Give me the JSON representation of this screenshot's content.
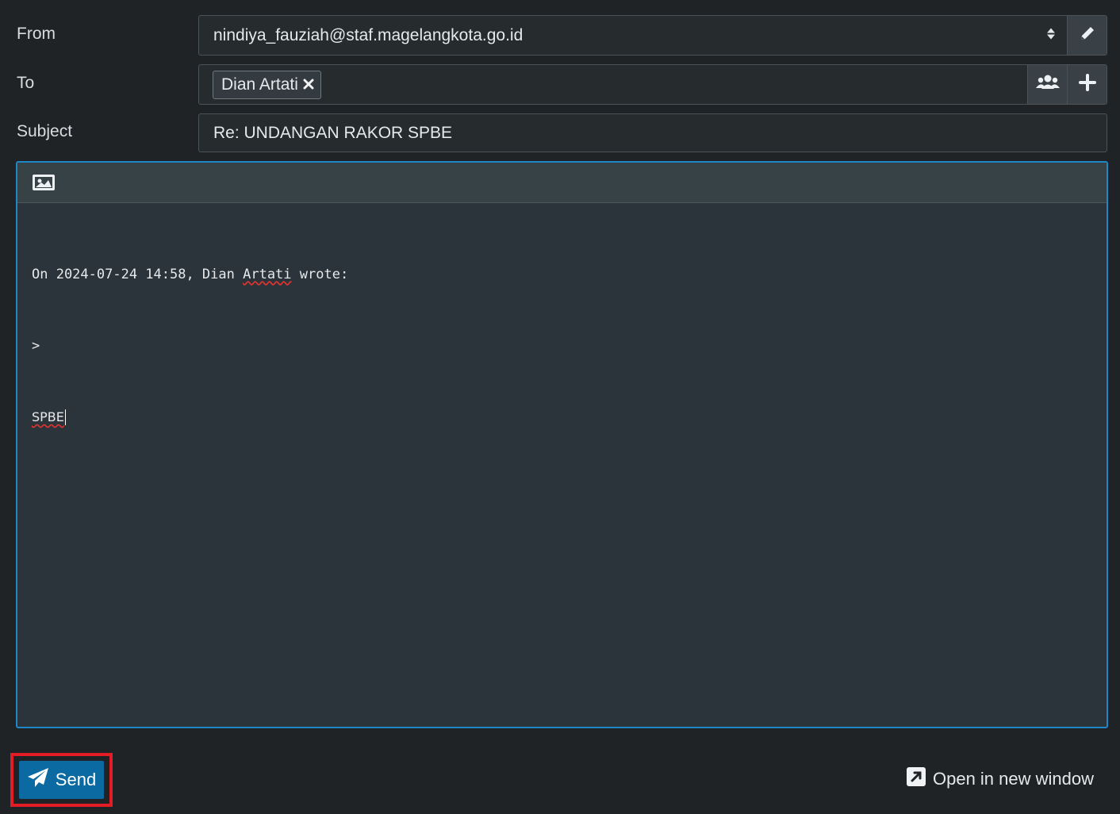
{
  "from": {
    "label": "From",
    "value": "nindiya_fauziah@staf.magelangkota.go.id",
    "select_icon": "sort-icon",
    "edit_icon": "pencil-icon"
  },
  "to": {
    "label": "To",
    "recipients": [
      "Dian Artati"
    ],
    "remove_icon": "close-icon",
    "addressbook_icon": "users-icon",
    "add_icon": "plus-icon"
  },
  "subject": {
    "label": "Subject",
    "value": "Re: UNDANGAN RAKOR SPBE"
  },
  "editor": {
    "toolbar_icon": "image-icon",
    "body": {
      "line1_prefix": "On 2024-07-24 14:58, Dian ",
      "line1_misspelled": "Artati",
      "line1_suffix": " wrote:",
      "line2": ">",
      "line3": "SPBE"
    }
  },
  "footer": {
    "send_label": "Send",
    "send_icon": "paper-plane-icon",
    "open_window_label": "Open in new window",
    "open_window_icon": "external-link-icon"
  }
}
